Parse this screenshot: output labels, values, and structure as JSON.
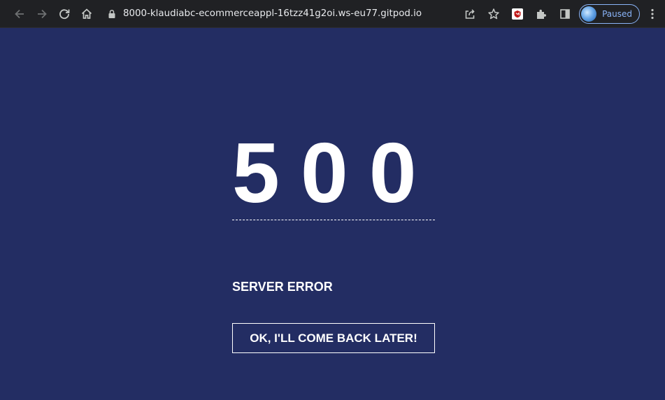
{
  "browser": {
    "url": "8000-klaudiabc-ecommerceappl-16tzz41g2oi.ws-eu77.gitpod.io",
    "profile_label": "Paused",
    "colors": {
      "toolbar_bg": "#202124",
      "icon": "#c4c7c5",
      "profile_accent": "#8ab4f8"
    },
    "icons": {
      "back": "arrow-left-icon",
      "forward": "arrow-right-icon",
      "reload": "reload-icon",
      "home": "home-icon",
      "lock": "lock-icon",
      "share": "share-icon",
      "bookmark": "star-icon",
      "extension": "mcafee-shield-icon",
      "extensions": "puzzle-icon",
      "side_panel": "side-panel-icon",
      "menu": "kebab-menu-icon"
    }
  },
  "page": {
    "background": "#232d63",
    "error_code": "500",
    "error_message": "SERVER ERROR",
    "button_label": "OK, I'LL COME BACK LATER!"
  }
}
